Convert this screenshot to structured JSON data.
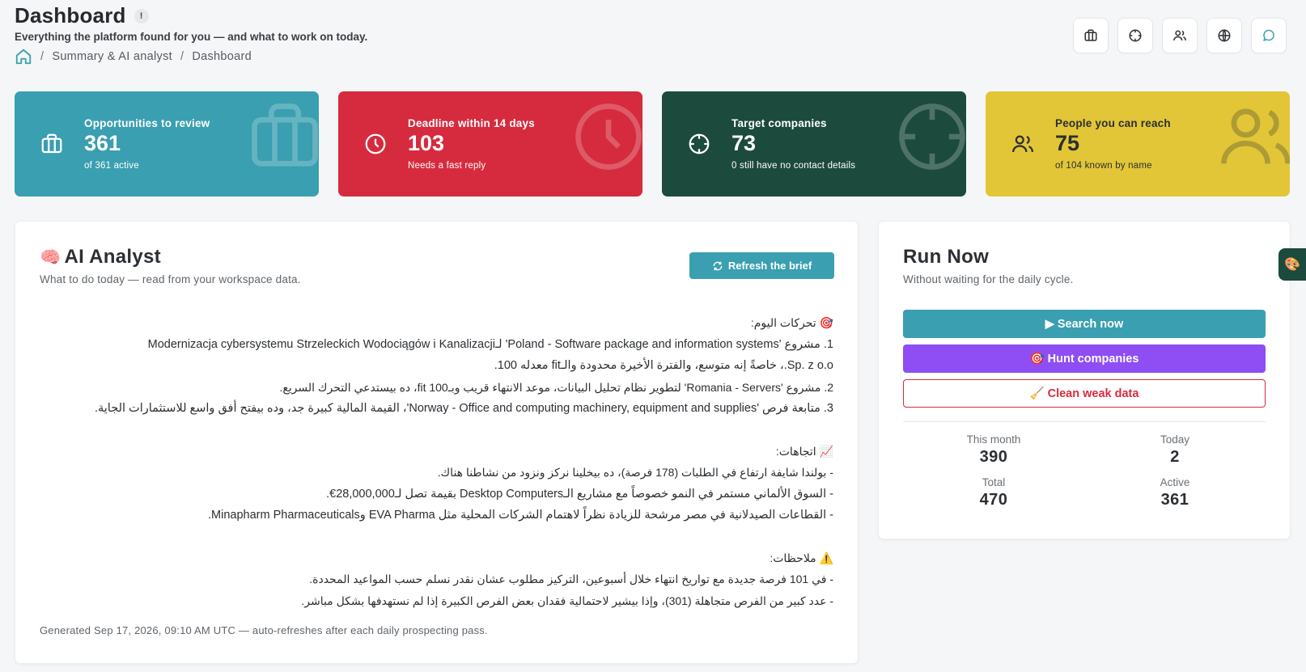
{
  "header": {
    "title": "Dashboard",
    "info_badge": "!",
    "subtitle": "Everything the platform found for you — and what to work on today.",
    "breadcrumb": [
      "Summary & AI analyst",
      "Dashboard"
    ],
    "separator": "/"
  },
  "top_actions": [
    {
      "icon": "briefcase-icon"
    },
    {
      "icon": "crosshair-icon"
    },
    {
      "icon": "users-icon"
    },
    {
      "icon": "globe-icon"
    },
    {
      "icon": "chat-icon"
    }
  ],
  "kpis": [
    {
      "label": "Opportunities to review",
      "value": "361",
      "sub": "of 361 active",
      "icon": "briefcase-icon",
      "color": "#3a9fb0"
    },
    {
      "label": "Deadline within 14 days",
      "value": "103",
      "sub": "Needs a fast reply",
      "icon": "clock-icon",
      "color": "#d62b3e"
    },
    {
      "label": "Target companies",
      "value": "73",
      "sub": "0 still have no contact details",
      "icon": "crosshair-icon",
      "color": "#1c4a3c"
    },
    {
      "label": "People you can reach",
      "value": "75",
      "sub": "of 104 known by name",
      "icon": "users-icon",
      "color": "#e2c637"
    }
  ],
  "analyst": {
    "emoji": "🧠",
    "title": "AI Analyst",
    "subtitle": "What to do today — read from your workspace data.",
    "refresh_label": "Refresh the brief",
    "brief": {
      "moves_heading": "🎯 تحركات اليوم:",
      "moves": [
        "1. مشروع 'Poland - Software package and information systems' لـModernizacja cybersystemu Strzeleckich Wodociągów i Kanalizacji",
        "Sp. z o.o.، خاصةً إنه متوسع، والفترة الأخيرة محدودة والـfit معدله 100.",
        "2. مشروع 'Romania - Servers' لتطوير نظام تحليل البيانات، موعد الانتهاء قريب وبـ100 fit، ده بيستدعي التحرك السريع.",
        "3. متابعة فرص 'Norway - Office and computing machinery, equipment and supplies'، القيمة المالية كبيرة جد، وده بيفتح أفق واسع للاستثمارات الجاية."
      ],
      "trends_heading": "📈 اتجاهات:",
      "trends": [
        "- بولندا شايفة ارتفاع في الطلبات (178 فرصة)، ده بيخلينا نركز ونزود من نشاطنا هناك.",
        "- السوق الألماني مستمر في النمو خصوصاً مع مشاريع الـDesktop Computers بقيمة تصل لـ28,000,000€.",
        "- القطاعات الصيدلانية في مصر مرشحة للزيادة نظراً لاهتمام الشركات المحلية مثل EVA Pharma وMinapharm Pharmaceuticals."
      ],
      "notes_heading": "⚠️ ملاحظات:",
      "notes": [
        "- في 101 فرصة جديدة مع تواريخ انتهاء خلال أسبوعين، التركيز مطلوب عشان نقدر نسلم حسب المواعيد المحددة.",
        "- عدد كبير من الفرص متجاهلة (301)، وإذا بيشير لاحتمالية فقدان بعض الفرص الكبيرة إذا لم نستهدفها بشكل مباشر."
      ]
    },
    "generated": "Generated Sep 17, 2026, 09:10 AM UTC — auto-refreshes after each daily prospecting pass."
  },
  "runnow": {
    "title": "Run Now",
    "subtitle": "Without waiting for the daily cycle.",
    "search_label": "▶ Search now",
    "hunt_label": "🎯 Hunt companies",
    "clean_label": "🧹 Clean weak data",
    "stats": [
      {
        "label": "This month",
        "value": "390"
      },
      {
        "label": "Today",
        "value": "2"
      },
      {
        "label": "Total",
        "value": "470"
      },
      {
        "label": "Active",
        "value": "361"
      }
    ]
  },
  "side_tab": {
    "icon": "palette-icon",
    "glyph": "🎨"
  }
}
